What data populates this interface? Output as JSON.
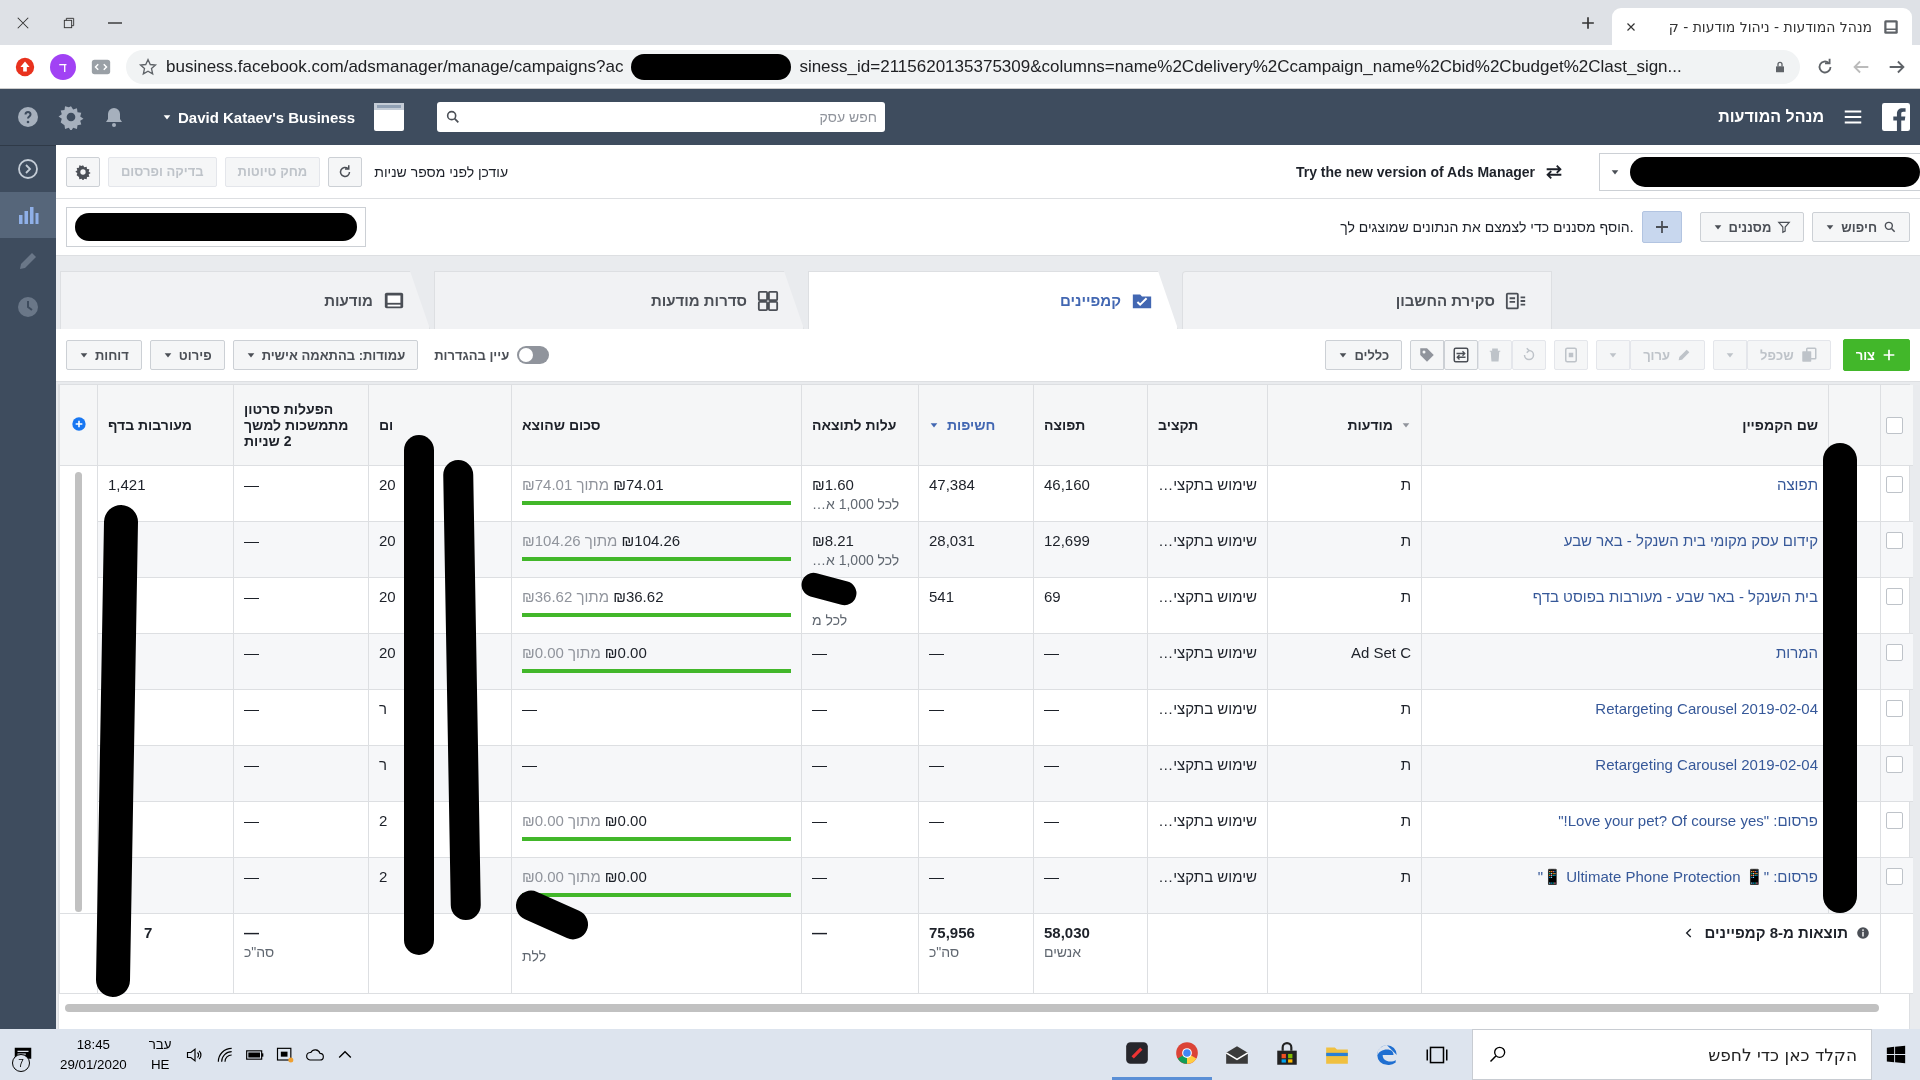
{
  "browser": {
    "tab_title": "מנהל המודעות - ניהול מודעות - ק",
    "profile_letter": "ד",
    "url_start": "business.facebook.com/adsmanager/manage/campaigns?ac",
    "url_end": "siness_id=2115620135375309&columns=name%2Cdelivery%2Ccampaign_name%2Cbid%2Cbudget%2Clast_sign..."
  },
  "header": {
    "title": "מנהל המודעות",
    "search_placeholder": "חפש עסק",
    "business": "David Kataev's Business"
  },
  "sidebar": [
    {
      "kind": "expand",
      "selected": false
    },
    {
      "kind": "chart",
      "selected": true
    },
    {
      "kind": "edit",
      "selected": false
    },
    {
      "kind": "history",
      "selected": false
    }
  ],
  "topbar": {
    "status": "עודכן לפני מספר שניות",
    "buttons": [
      {
        "label": "מחק טיוטות",
        "disabled": true
      },
      {
        "label": "בדיקה ופרסום",
        "disabled": true
      }
    ],
    "new_version": "Try the new version of Ads Manager"
  },
  "filterbar": {
    "search": "חיפוש",
    "filters": "מסננים",
    "hint": "הוסף מסננים כדי לצמצם את הנתונים שמוצגים לך."
  },
  "tabs": [
    {
      "label": "סקירת החשבון",
      "kind": "overview",
      "selected": false
    },
    {
      "label": "קמפיינים",
      "kind": "campaigns",
      "selected": true
    },
    {
      "label": "סדרות מודעות",
      "kind": "adsets",
      "selected": false
    },
    {
      "label": "מודעות",
      "kind": "ads",
      "selected": false
    }
  ],
  "actions": {
    "create": "צור",
    "duplicate": {
      "label": "שכפל",
      "disabled": true
    },
    "edit": {
      "label": "ערוך",
      "disabled": true
    },
    "rules": "כללים",
    "view_setup": {
      "label": "עיין בהגדרות",
      "on": false
    },
    "columns": "עמודות: בהתאמה אישית",
    "breakdown": "פירוט",
    "reports": "דוחות"
  },
  "table": {
    "all_checked": false,
    "columns": [
      {
        "label": "שם הקמפיין",
        "menu": false,
        "sorted": false
      },
      {
        "label": "מודעות",
        "menu": true,
        "sorted": false
      },
      {
        "label": "תקציב",
        "menu": false,
        "sorted": false
      },
      {
        "label": "תפוצה",
        "menu": false,
        "sorted": false
      },
      {
        "label": "חשיפות",
        "menu": false,
        "sorted": true
      },
      {
        "label": "עלות לתוצאה",
        "menu": false,
        "sorted": false
      },
      {
        "label": "סכום שהוצא",
        "menu": false,
        "sorted": false
      },
      {
        "label": "ום",
        "menu": false,
        "sorted": false
      },
      {
        "label": "הפעלות סרטון מתמשכות למשך 2 שניות",
        "menu": false,
        "sorted": false
      },
      {
        "label": "מעורבות בדף",
        "menu": false,
        "sorted": false
      }
    ],
    "rows": [
      {
        "checked": false,
        "name": "תפוצה",
        "ads": "ת",
        "budget": "שימוש בתקצי…",
        "reach": "46,160",
        "impressions": "47,384",
        "cost": "₪1.60",
        "cost_note": "לכל 1,000 א…",
        "spent": "₪74.01",
        "spent_of": "מתוך ₪74.01",
        "level": 1,
        "date": "20",
        "video": "—",
        "engagement": "1,421"
      },
      {
        "checked": false,
        "name": "קידום עסק מקומי בית השנקל - באר שבע",
        "ads": "ת",
        "budget": "שימוש בתקצי…",
        "reach": "12,699",
        "impressions": "28,031",
        "cost": "₪8.21",
        "cost_note": "לכל 1,000 א…",
        "spent": "₪104.26",
        "spent_of": "מתוך ₪104.26",
        "level": 1,
        "date": "20",
        "video": "—"
      },
      {
        "checked": false,
        "name": "בית השנקל - באר שבע - מעורבות בפוסט בדף",
        "ads": "ת",
        "budget": "שימוש בתקצי…",
        "reach": "69",
        "impressions": "541",
        "cost_note": "לכל מ",
        "spent": "₪36.62",
        "spent_of": "מתוך ₪36.62",
        "level": 1,
        "date": "20",
        "video": "—"
      },
      {
        "checked": false,
        "name": "המרות",
        "ads": "Ad Set C",
        "budget": "שימוש בתקצי…",
        "reach": "—",
        "impressions": "—",
        "cost": "—",
        "spent": "₪0.00",
        "spent_of": "מתוך ₪0.00",
        "level": 1,
        "date": "20",
        "video": "—"
      },
      {
        "checked": false,
        "name": "Retargeting Carousel 2019-02-04",
        "ads": "ת",
        "budget": "שימוש בתקצי…",
        "reach": "—",
        "impressions": "—",
        "cost": "—",
        "spent": "—",
        "date": "ר",
        "video": "—"
      },
      {
        "checked": false,
        "name": "Retargeting Carousel 2019-02-04",
        "ads": "ת",
        "budget": "שימוש בתקצי…",
        "reach": "—",
        "impressions": "—",
        "cost": "—",
        "spent": "—",
        "date": "ר",
        "video": "—"
      },
      {
        "checked": false,
        "name": "פרסום: \"Love your pet? Of course yes!\"",
        "ads": "ת",
        "budget": "שימוש בתקצי…",
        "reach": "—",
        "impressions": "—",
        "cost": "—",
        "spent": "₪0.00",
        "spent_of": "מתוך ₪0.00",
        "level": 1,
        "date": "2",
        "video": "—"
      },
      {
        "checked": false,
        "name": "פרסום: \"📱 Ultimate Phone Protection 📱\"",
        "ads": "ת",
        "budget": "שימוש בתקצי…",
        "reach": "—",
        "impressions": "—",
        "cost": "—",
        "spent": "₪0.00",
        "spent_of": "מתוך ₪0.00",
        "level": 1,
        "date": "2",
        "video": "—"
      }
    ],
    "summary": {
      "label": "תוצאות מ-8 קמפיינים",
      "reach": "58,030",
      "reach_note": "אנשים",
      "impressions": "75,956",
      "impressions_note": "סה\"כ",
      "cost": "—",
      "spent_note": "ללת",
      "video": "—",
      "video_note": "סה\"כ",
      "engagement": "7"
    }
  },
  "taskbar": {
    "search_placeholder": "הקלד כאן כדי לחפש",
    "time": "18:45",
    "date": "29/01/2020",
    "lang_top": "עבר",
    "lang": "HE",
    "notifications": "7"
  }
}
